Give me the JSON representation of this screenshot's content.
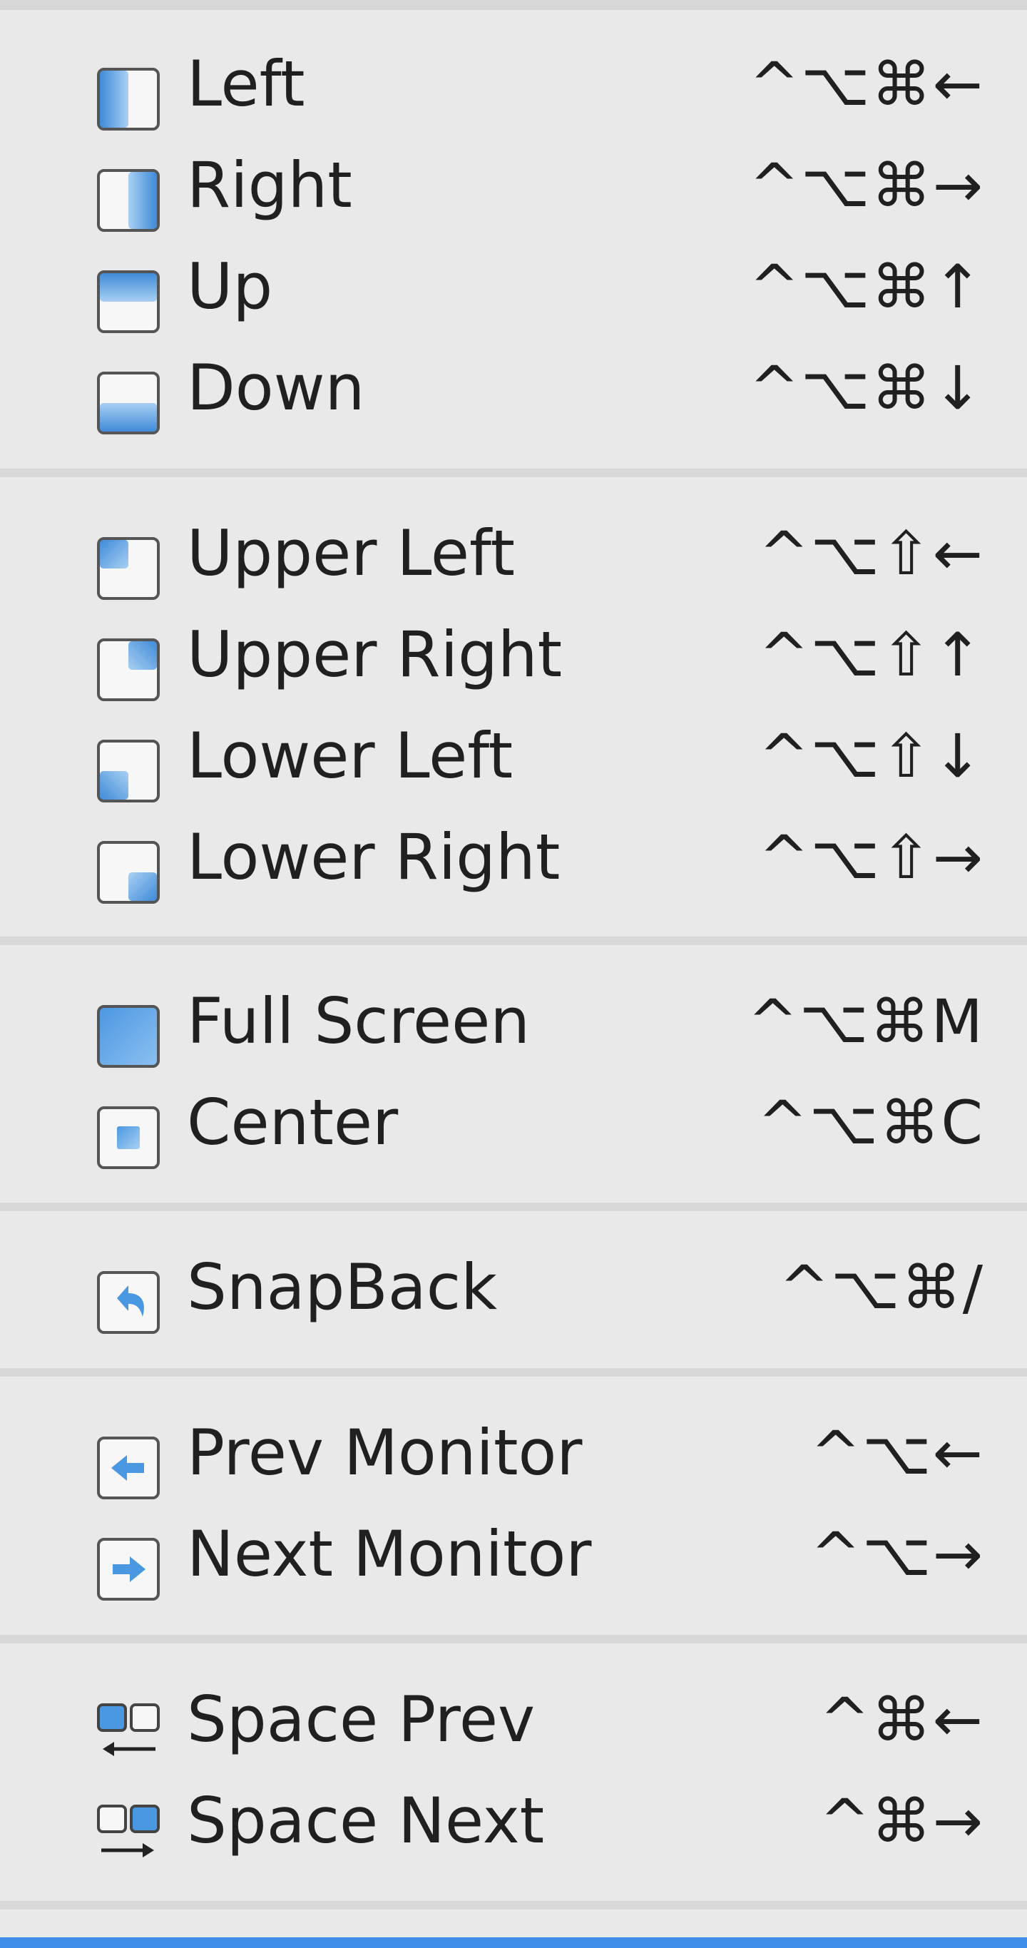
{
  "colors": {
    "menu_bg": "#e9e9e9",
    "separator": "#d8d8d8",
    "accent_blue": "#4a97e2",
    "selection_bar": "#3f8ee8"
  },
  "groups": [
    {
      "items": [
        {
          "label": "Left",
          "shortcut": "^⌥⌘←",
          "icon": "left-half-icon"
        },
        {
          "label": "Right",
          "shortcut": "^⌥⌘→",
          "icon": "right-half-icon"
        },
        {
          "label": "Up",
          "shortcut": "^⌥⌘↑",
          "icon": "top-half-icon"
        },
        {
          "label": "Down",
          "shortcut": "^⌥⌘↓",
          "icon": "bottom-half-icon"
        }
      ]
    },
    {
      "items": [
        {
          "label": "Upper Left",
          "shortcut": "^⌥⇧←",
          "icon": "upper-left-quarter-icon"
        },
        {
          "label": "Upper Right",
          "shortcut": "^⌥⇧↑",
          "icon": "upper-right-quarter-icon"
        },
        {
          "label": "Lower Left",
          "shortcut": "^⌥⇧↓",
          "icon": "lower-left-quarter-icon"
        },
        {
          "label": "Lower Right",
          "shortcut": "^⌥⇧→",
          "icon": "lower-right-quarter-icon"
        }
      ]
    },
    {
      "items": [
        {
          "label": "Full Screen",
          "shortcut": "^⌥⌘M",
          "icon": "full-screen-icon"
        },
        {
          "label": "Center",
          "shortcut": "^⌥⌘C",
          "icon": "center-icon"
        }
      ]
    },
    {
      "items": [
        {
          "label": "SnapBack",
          "shortcut": "^⌥⌘/",
          "icon": "snapback-icon"
        }
      ]
    },
    {
      "items": [
        {
          "label": "Prev Monitor",
          "shortcut": "^⌥←",
          "icon": "prev-monitor-icon"
        },
        {
          "label": "Next Monitor",
          "shortcut": "^⌥→",
          "icon": "next-monitor-icon"
        }
      ]
    },
    {
      "items": [
        {
          "label": "Space Prev",
          "shortcut": "^⌘←",
          "icon": "space-prev-icon"
        },
        {
          "label": "Space Next",
          "shortcut": "^⌘→",
          "icon": "space-next-icon"
        }
      ]
    }
  ]
}
